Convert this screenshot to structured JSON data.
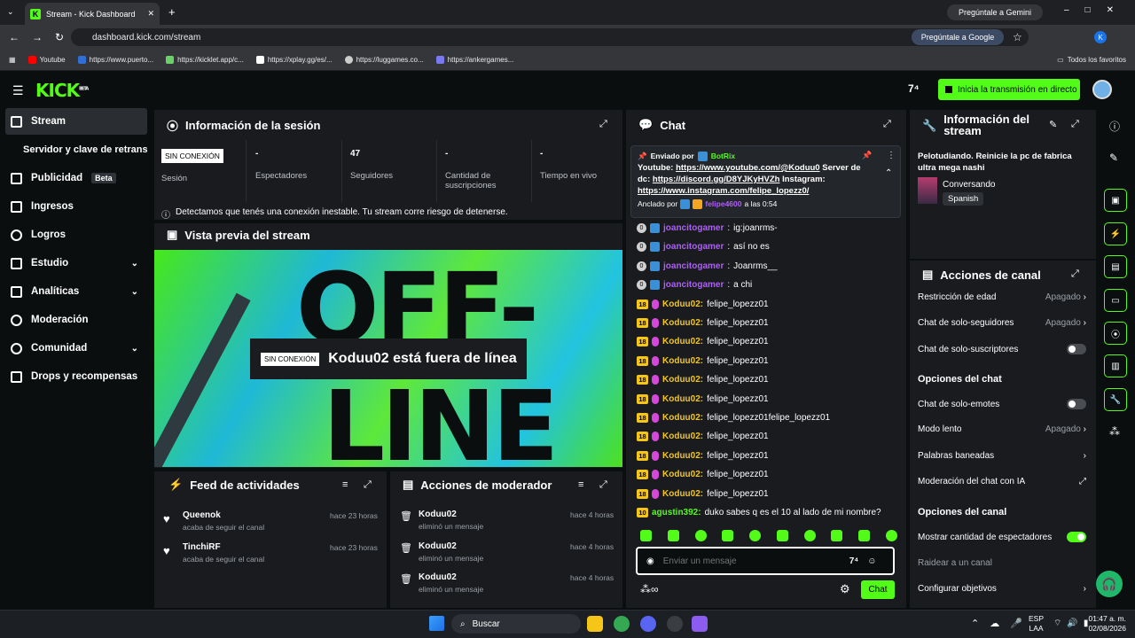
{
  "browser": {
    "tab_title": "Stream - Kick Dashboard",
    "url": "dashboard.kick.com/stream",
    "gemini": "Pregúntale a Gemini",
    "ask_google": "Pregúntale a Google",
    "profile": "K",
    "bookmarks": [
      "Youtube",
      "https://www.puerto...",
      "https://kicklet.app/c...",
      "https://xplay.gg/es/...",
      "https://luggames.co...",
      "https://ankergames..."
    ],
    "all_bookmarks": "Todos los favoritos"
  },
  "header": {
    "logo": "KICK",
    "logo_sup": "BETA",
    "go_live": "Inicia la transmisión en directo"
  },
  "sidebar": {
    "items": [
      {
        "label": "Stream"
      },
      {
        "label": "Servidor y clave de retransmisión"
      },
      {
        "label": "Publicidad",
        "badge": "Beta"
      },
      {
        "label": "Ingresos"
      },
      {
        "label": "Logros"
      },
      {
        "label": "Estudio"
      },
      {
        "label": "Analíticas"
      },
      {
        "label": "Moderación"
      },
      {
        "label": "Comunidad"
      },
      {
        "label": "Drops y recompensas"
      }
    ]
  },
  "session": {
    "title": "Información de la sesión",
    "status_badge": "SIN CONEXIÓN",
    "status_label": "Sesión",
    "viewers_val": "-",
    "viewers": "Espectadores",
    "followers_val": "47",
    "followers": "Seguidores",
    "subs_val": "-",
    "subs": "Cantidad de suscripciones",
    "live_val": "-",
    "live": "Tiempo en vivo",
    "warning": "Detectamos que tenés una conexión inestable. Tu stream corre riesgo de detenerse."
  },
  "preview": {
    "title": "Vista previa del stream",
    "badge": "SIN CONEXIÓN",
    "offline_msg": "Koduu02 está fuera de línea",
    "bg_word1": "OFF-",
    "bg_word2": "LINE"
  },
  "activity": {
    "title": "Feed de actividades",
    "items": [
      {
        "user": "Queenok",
        "action": "acaba de seguir el canal",
        "time": "hace 23 horas"
      },
      {
        "user": "TinchiRF",
        "action": "acaba de seguir el canal",
        "time": "hace 23 horas"
      }
    ]
  },
  "modactions": {
    "title": "Acciones de moderador",
    "items": [
      {
        "user": "Koduu02",
        "action": "eliminó un mensaje",
        "time": "hace 4 horas"
      },
      {
        "user": "Koduu02",
        "action": "eliminó un mensaje",
        "time": "hace 4 horas"
      },
      {
        "user": "Koduu02",
        "action": "eliminó un mensaje",
        "time": "hace 4 horas"
      }
    ]
  },
  "chat": {
    "title": "Chat",
    "pinned_by": "Enviado por",
    "pinned_user": "BotRix",
    "pinned_line1_pre": "Youtube: ",
    "pinned_link1": "https://www.youtube.com/@Koduu0",
    "pinned_line1_post": " Server de",
    "pinned_line2_pre": "dc: ",
    "pinned_link2": "https://discord.gg/D8YJKyHVZh",
    "pinned_line2_post": " Instagram:",
    "pinned_link3": "https://www.instagram.com/felipe_lopezz0/",
    "anchored": "Anclado por",
    "anchored_user": "felipe4600",
    "anchored_time": "a las 0:54",
    "messages": [
      {
        "badge": "0",
        "user": "joancitogamer",
        "text": "ig:joanrms-",
        "color": "#b05cff"
      },
      {
        "badge": "0",
        "user": "joancitogamer",
        "text": "así no es",
        "color": "#b05cff"
      },
      {
        "badge": "0",
        "user": "joancitogamer",
        "text": "Joanrms__",
        "color": "#b05cff"
      },
      {
        "badge": "0",
        "user": "joancitogamer",
        "text": "a chi",
        "color": "#b05cff"
      },
      {
        "badge": "18",
        "user": "Koduu02:",
        "text": "felipe_lopezz01",
        "color": "#f5c518"
      },
      {
        "badge": "18",
        "user": "Koduu02:",
        "text": "felipe_lopezz01",
        "color": "#f5c518"
      },
      {
        "badge": "18",
        "user": "Koduu02:",
        "text": "felipe_lopezz01",
        "color": "#f5c518"
      },
      {
        "badge": "18",
        "user": "Koduu02:",
        "text": "felipe_lopezz01",
        "color": "#f5c518"
      },
      {
        "badge": "18",
        "user": "Koduu02:",
        "text": "felipe_lopezz01",
        "color": "#f5c518"
      },
      {
        "badge": "18",
        "user": "Koduu02:",
        "text": "felipe_lopezz01",
        "color": "#f5c518"
      },
      {
        "badge": "18",
        "user": "Koduu02:",
        "text": "felipe_lopezz01felipe_lopezz01",
        "color": "#f5c518"
      },
      {
        "badge": "18",
        "user": "Koduu02:",
        "text": "felipe_lopezz01",
        "color": "#f5c518"
      },
      {
        "badge": "18",
        "user": "Koduu02:",
        "text": "felipe_lopezz01",
        "color": "#f5c518"
      },
      {
        "badge": "18",
        "user": "Koduu02:",
        "text": "felipe_lopezz01",
        "color": "#f5c518"
      },
      {
        "badge": "18",
        "user": "Koduu02:",
        "text": "felipe_lopezz01",
        "color": "#f5c518"
      },
      {
        "badge": "10",
        "user": "agustin392:",
        "text": "duko sabes q es el 10 al lado de mi nombre?",
        "color": "#53fc18"
      }
    ],
    "input_placeholder": "Enviar un mensaje",
    "send": "Chat"
  },
  "streaminfo": {
    "title": "Información del stream",
    "description": "Pelotudiando. Reinicie la pc de fabrica ultra mega nashi",
    "category": "Conversando",
    "language": "Spanish"
  },
  "channel": {
    "title": "Acciones de canal",
    "options": [
      {
        "label": "Restricción de edad",
        "value": "Apagado"
      },
      {
        "label": "Chat de solo-seguidores",
        "value": "Apagado"
      },
      {
        "label": "Chat de solo-suscriptores",
        "toggle": false
      }
    ],
    "chat_options_title": "Opciones del chat",
    "chat_options": [
      {
        "label": "Chat de solo-emotes",
        "toggle": false
      },
      {
        "label": "Modo lento",
        "value": "Apagado"
      },
      {
        "label": "Palabras baneadas"
      },
      {
        "label": "Moderación del chat con IA"
      }
    ],
    "channel_options_title": "Opciones del canal",
    "channel_options": [
      {
        "label": "Mostrar cantidad de espectadores",
        "toggle": true
      },
      {
        "label": "Raidear a un canal"
      },
      {
        "label": "Configurar objetivos"
      }
    ]
  },
  "taskbar": {
    "search": "Buscar",
    "lang": "ESP",
    "lang2": "LAA",
    "time": "01:47 a. m.",
    "date": "02/08/2026"
  }
}
